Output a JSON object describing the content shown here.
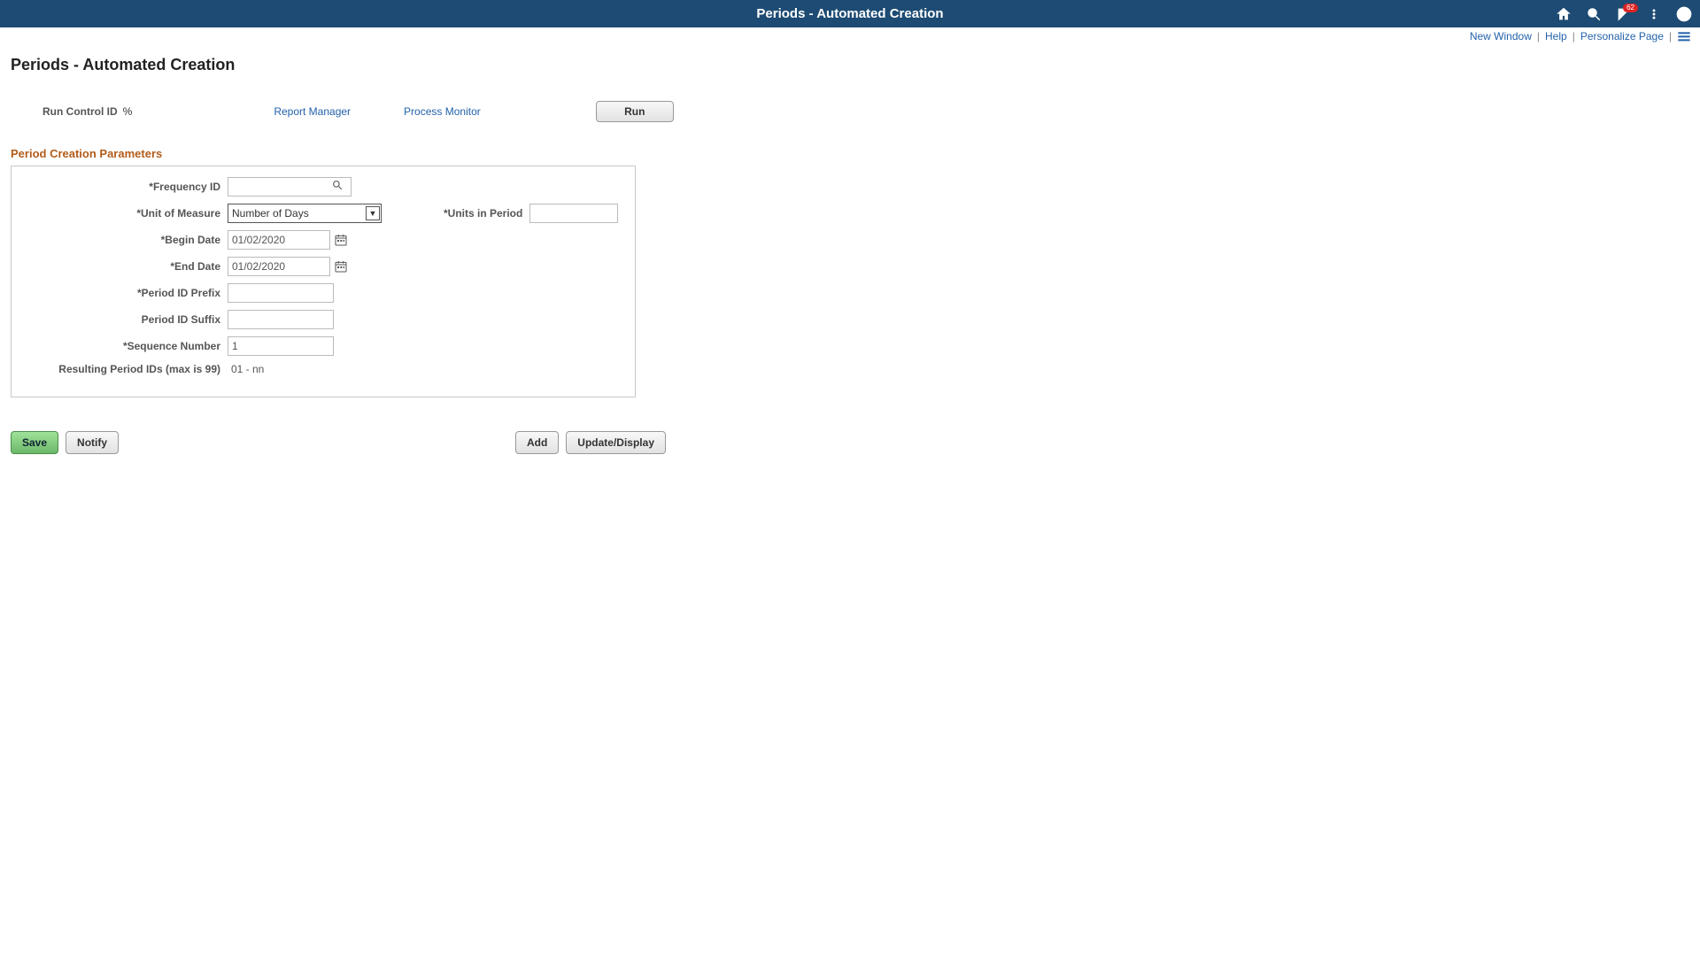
{
  "header": {
    "title": "Periods - Automated Creation",
    "notification_count": "62"
  },
  "subnav": {
    "new_window": "New Window",
    "help": "Help",
    "personalize": "Personalize Page"
  },
  "page": {
    "title": "Periods - Automated Creation"
  },
  "run_row": {
    "label": "Run Control ID",
    "value": "%",
    "report_manager": "Report Manager",
    "process_monitor": "Process Monitor",
    "run_button": "Run"
  },
  "section": {
    "title": "Period Creation Parameters",
    "labels": {
      "frequency_id": "*Frequency ID",
      "unit_of_measure": "*Unit of Measure",
      "units_in_period": "*Units in Period",
      "begin_date": "*Begin Date",
      "end_date": "*End Date",
      "period_prefix": "*Period ID Prefix",
      "period_suffix": "Period ID Suffix",
      "sequence_number": "*Sequence Number",
      "resulting": "Resulting Period IDs (max is 99)"
    },
    "values": {
      "frequency_id": "",
      "unit_of_measure": "Number of Days",
      "units_in_period": "",
      "begin_date": "01/02/2020",
      "end_date": "01/02/2020",
      "period_prefix": "",
      "period_suffix": "",
      "sequence_number": "1",
      "resulting": "01 - nn"
    }
  },
  "footer": {
    "save": "Save",
    "notify": "Notify",
    "add": "Add",
    "update_display": "Update/Display"
  }
}
